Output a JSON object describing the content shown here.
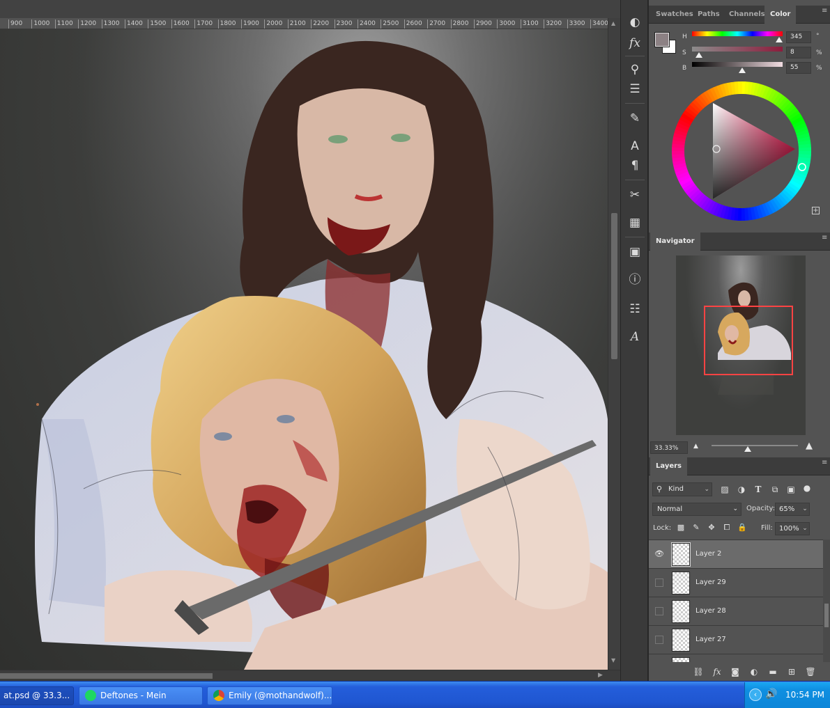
{
  "document_tab": {
    "label": "at.psd @ 33.3..."
  },
  "ruler": {
    "ticks": [
      "900",
      "1000",
      "1100",
      "1200",
      "1300",
      "1400",
      "1500",
      "1600",
      "1700",
      "1800",
      "1900",
      "2000",
      "2100",
      "2200",
      "2300",
      "2400",
      "2500",
      "2600",
      "2700",
      "2800",
      "2900",
      "3000",
      "3100",
      "3200",
      "3300",
      "3400"
    ]
  },
  "toolstrip": {
    "icons": [
      "brush-preset-icon",
      "fx-icon",
      "clone-source-icon",
      "adjustments-icon",
      "brush-settings-icon",
      "character-icon",
      "paragraph-icon",
      "tool-presets-icon",
      "grid-icon",
      "timeline-icon",
      "info-icon",
      "properties-icon",
      "glyphs-icon"
    ]
  },
  "color_panel": {
    "tabs": [
      "Swatches",
      "Paths",
      "Channels",
      "Color"
    ],
    "active_tab": "Color",
    "foreground": "#8c8184",
    "background": "#ffffff",
    "h": {
      "label": "H",
      "value": "345",
      "unit": "°",
      "level": 0.958
    },
    "s": {
      "label": "S",
      "value": "8",
      "unit": "%",
      "level": 0.08
    },
    "b": {
      "label": "B",
      "value": "55",
      "unit": "%",
      "level": 0.55
    }
  },
  "navigator": {
    "title": "Navigator",
    "zoom": "33.33%",
    "frame_color": "#ff4343"
  },
  "layers": {
    "title": "Layers",
    "filter": "Kind",
    "blend_mode": "Normal",
    "opacity_label": "Opacity:",
    "opacity": "65%",
    "lock_label": "Lock:",
    "fill_label": "Fill:",
    "fill": "100%",
    "items": [
      {
        "name": "Layer 2",
        "visible": true,
        "selected": true
      },
      {
        "name": "Layer 29",
        "visible": false,
        "selected": false
      },
      {
        "name": "Layer 28",
        "visible": false,
        "selected": false
      },
      {
        "name": "Layer 27",
        "visible": false,
        "selected": false
      }
    ]
  },
  "taskbar": {
    "tasks": [
      {
        "label": "at.psd @ 33.3...",
        "icon": "photoshop-icon"
      },
      {
        "label": "Deftones - Mein",
        "icon": "spotify-icon",
        "icon_color": "#1ed760"
      },
      {
        "label": "Emily (@mothandwolf)...",
        "icon": "chrome-icon"
      }
    ],
    "clock": "10:54 PM",
    "color": "#245edb"
  }
}
